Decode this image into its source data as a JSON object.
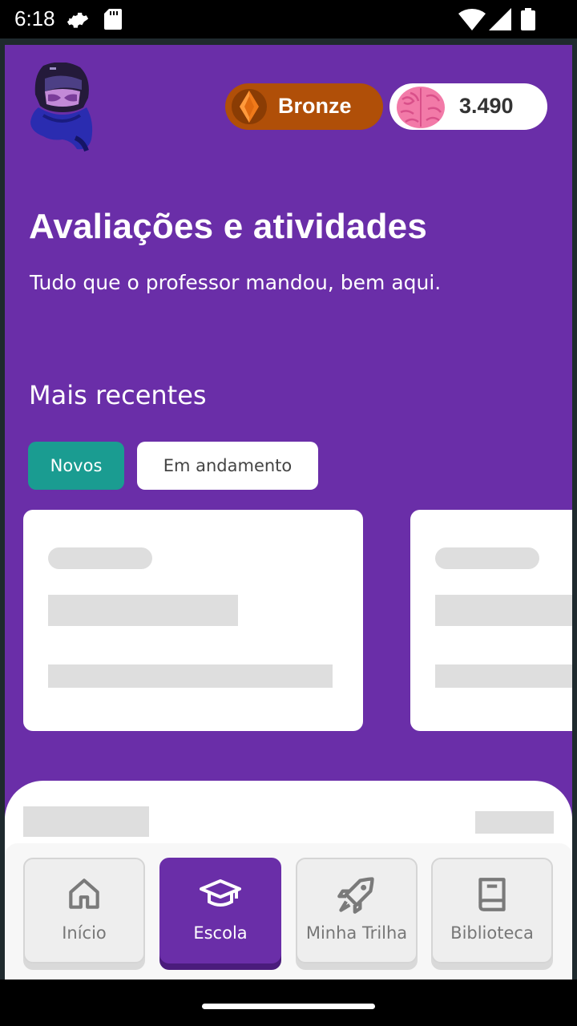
{
  "status_bar": {
    "time": "6:18"
  },
  "header": {
    "league_label": "Bronze",
    "score_value": "3.490"
  },
  "page": {
    "title": "Avaliações e atividades",
    "subtitle": "Tudo que o professor mandou, bem aqui."
  },
  "recent": {
    "section_title": "Mais recentes",
    "filters": [
      {
        "label": "Novos",
        "selected": true
      },
      {
        "label": "Em andamento",
        "selected": false
      }
    ]
  },
  "bottom_nav": {
    "items": [
      {
        "label": "Início",
        "icon": "home-icon",
        "active": false
      },
      {
        "label": "Escola",
        "icon": "graduation-cap-icon",
        "active": true
      },
      {
        "label": "Minha Trilha",
        "icon": "rocket-icon",
        "active": false
      },
      {
        "label": "Biblioteca",
        "icon": "book-icon",
        "active": false
      }
    ]
  },
  "colors": {
    "primary": "#6a2ea8",
    "bronze": "#b04f08",
    "accent_teal": "#1a9c91"
  }
}
